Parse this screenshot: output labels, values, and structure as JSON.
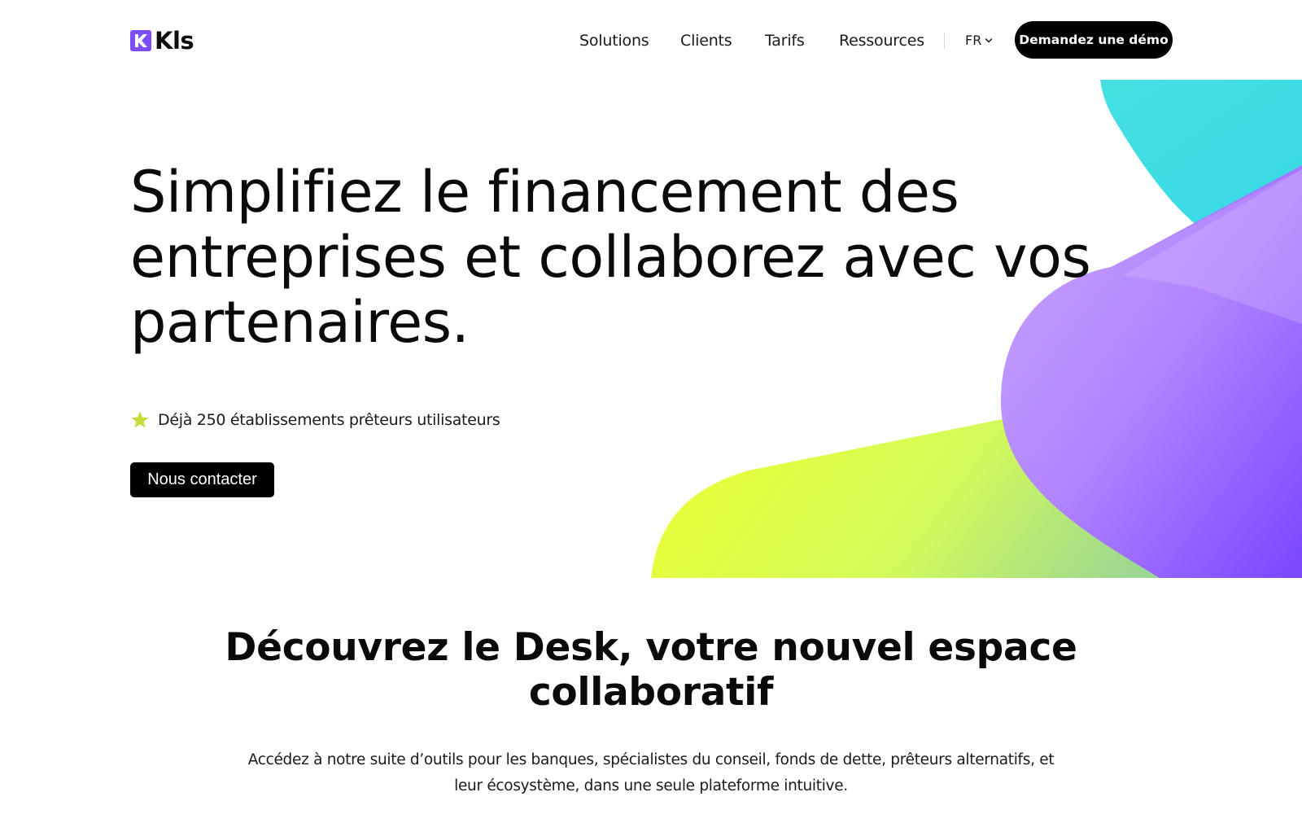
{
  "header": {
    "logo_text": "Kls",
    "nav": [
      {
        "label": "Solutions"
      },
      {
        "label": "Clients"
      },
      {
        "label": "Tarifs"
      },
      {
        "label": "Ressources"
      }
    ],
    "lang": "FR",
    "demo_label": "Demandez une démo"
  },
  "hero": {
    "title_lines": [
      "Simplifiez le financement des",
      "entreprises et collaborez avec vos",
      "partenaires."
    ],
    "badge_text": "Déjà 250 établissements prêteurs utilisateurs",
    "cta_label": "Nous contacter"
  },
  "section": {
    "title_lines": [
      "Découvrez le Desk, votre nouvel espace",
      "collaboratif"
    ],
    "desc_lines": [
      "Accédez à notre suite d’outils pour les banques, spécialistes du conseil, fonds de dette, prêteurs alternatifs, et",
      "leur écosystème, dans une seule plateforme intuitive."
    ]
  },
  "colors": {
    "brand_purple": "#7c4dff",
    "cyan": "#3fdde4",
    "lime": "#e4ff3c",
    "star": "#c8d93a",
    "button_black": "#000000"
  }
}
